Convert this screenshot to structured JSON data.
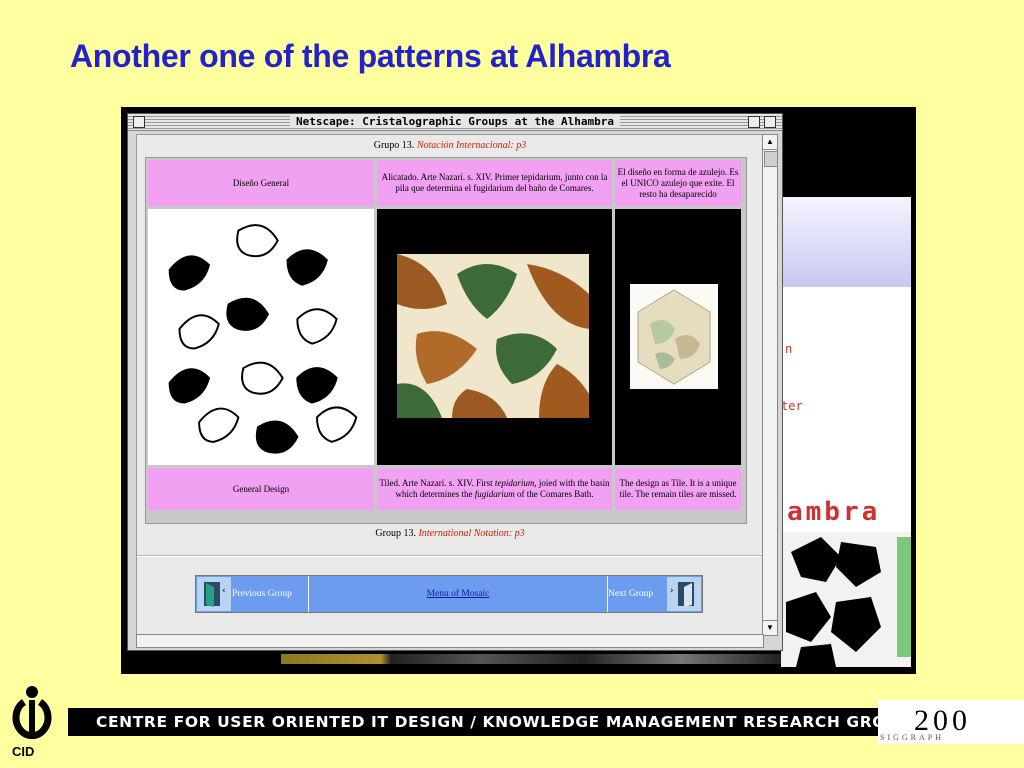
{
  "slide": {
    "title": "Another one of the patterns at Alhambra"
  },
  "browser": {
    "window_title": "Netscape: Cristalographic Groups at the Alhambra",
    "header_grupo": "Grupo 13.",
    "header_notacion": "Notación Internacional:",
    "header_p3": "p3",
    "footer_group": "Group 13.",
    "footer_notation": "International Notation:",
    "footer_p3": "p3",
    "table": {
      "row1": {
        "c1": "Diseño General",
        "c2": "Alicatado. Arte Nazarí. s. XIV. Primer tepidarium, junto con la pila que determina el fugidarium del baño de Comares.",
        "c3": "El diseño en forma de azulejo. Es el UNICO azulejo que exite. El resto ha desaparecido"
      },
      "row3": {
        "c1": "General Design",
        "c2_a": "Tiled. Arte Nazarí. s. XIV. First",
        "c2_tep": "tepidarium",
        "c2_b": ", joied with the basin which determines the",
        "c2_fug": "fugidarium",
        "c2_c": "of the Comares Bath.",
        "c3": "The design as Tile. It is a unique tile. The remain tiles are missed."
      }
    },
    "nav": {
      "previous": "Previous Group",
      "menu": "Menu of Mosaic",
      "next": "Next Group"
    }
  },
  "background_window": {
    "fragment_n": "n",
    "fragment_ter": "ter",
    "fragment_ambra": "ambra"
  },
  "footer": {
    "banner": "CENTRE FOR USER ORIENTED IT DESIGN  /  KNOWLEDGE MANAGEMENT RESEARCH GROUP",
    "cid_label": "CID",
    "siggraph_year": "200",
    "siggraph_label": "SIGGRAPH"
  },
  "colors": {
    "slide_bg": "#ffffa0",
    "title": "#2222cc",
    "pink_cell": "#f2a0f2",
    "nav_blue": "#6c9cf0"
  }
}
